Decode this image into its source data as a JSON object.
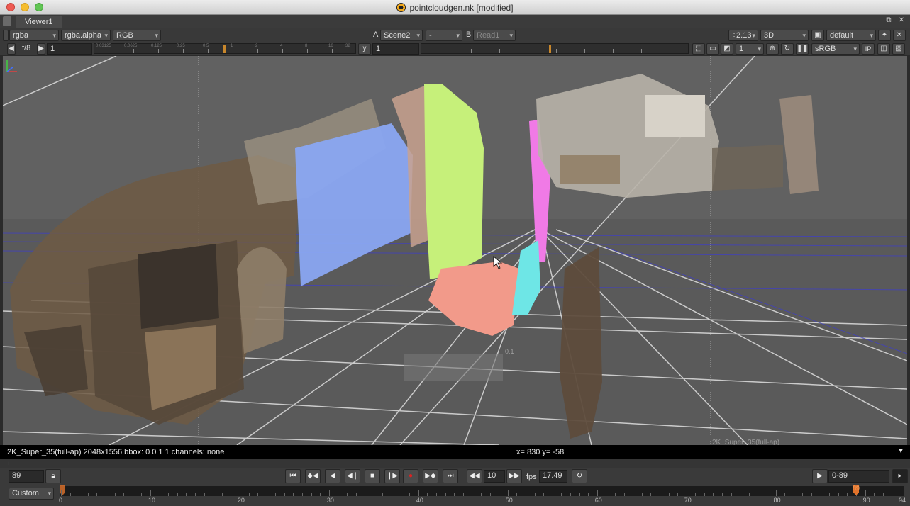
{
  "window": {
    "title": "pointcloudgen.nk [modified]"
  },
  "tabs": [
    {
      "label": "Viewer1"
    }
  ],
  "toolbar1": {
    "channels": "rgba",
    "alpha": "rgba.alpha",
    "display": "RGB",
    "a_label": "A",
    "input_a": "Scene2",
    "compare": "-",
    "b_label": "B",
    "input_b": "Read1",
    "zoom": "÷2.13",
    "view_mode": "3D",
    "camera": "default"
  },
  "toolbar2": {
    "fstop": "f/8",
    "gain": "1",
    "gamma_label": "y",
    "gamma": "1",
    "proxy": "1",
    "lut": "sRGB",
    "ip_label": "IP"
  },
  "gain_ruler_labels": [
    "0.03125",
    "0.0625",
    "0.125",
    "0.25",
    "0.5",
    "1",
    "2",
    "4",
    "8",
    "16",
    "32"
  ],
  "viewer": {
    "format_label": "2K_Super_35(full-ap)",
    "grid_label": "0.1"
  },
  "info_bar": {
    "format": "2K_Super_35(full-ap) 2048x1556 bbox: 0 0 1 1 channels: none",
    "coords": "x= 830 y= -58"
  },
  "transport": {
    "current_frame": "89",
    "increment": "10",
    "fps_label": "fps",
    "fps": "17.49",
    "range": "0-89"
  },
  "timeline": {
    "range_mode": "Custom",
    "ticks": [
      "0",
      "10",
      "20",
      "30",
      "40",
      "50",
      "60",
      "70",
      "80",
      "90",
      "94"
    ],
    "playhead_frame": "89",
    "playhead_value": 89,
    "start": 0,
    "end": 94
  },
  "colors": {
    "viewer_bg": "#5f5f5f",
    "cloud_blue": "#8aa6f2",
    "cloud_green": "#c6f07a",
    "cloud_pink": "#f29a8a",
    "cloud_magenta": "#f07ae6",
    "cloud_cyan": "#6ee6e6",
    "playhead": "#e2732b"
  }
}
